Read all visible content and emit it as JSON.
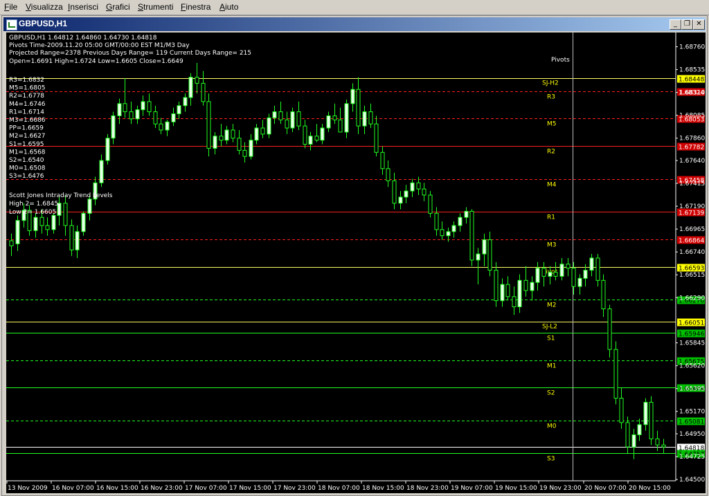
{
  "menubar": {
    "items": [
      {
        "label": "File"
      },
      {
        "label": "Visualizza"
      },
      {
        "label": "Inserisci"
      },
      {
        "label": "Grafici"
      },
      {
        "label": "Strumenti"
      },
      {
        "label": "Finestra"
      },
      {
        "label": "Aiuto"
      }
    ]
  },
  "window": {
    "title": "GBPUSD,H1",
    "buttons": {
      "minimize": "_",
      "restore": "❐",
      "close": "✕"
    }
  },
  "info": {
    "line1": "GBPUSD,H1  1.64812 1.64860 1.64730 1.64818",
    "line2": "Pivots Time-2009.11.20 05:00 GMT/00:00 EST M1/M3 Day",
    "line3": "Projected Range=2378 Previous Days Range= 119 Current Days Range= 215",
    "line4": "Open=1.6691 High=1.6724 Low=1.6605 Close=1.6649",
    "levels": [
      "R3=1.6832",
      "M5=1.6805",
      "R2=1.6778",
      "M4=1.6746",
      "R1=1.6714",
      "M3=1.6686",
      "PP=1.6659",
      "M2=1.6627",
      "S1=1.6595",
      "M1=1.6568",
      "S2=1.6540",
      "M0=1.6508",
      "S3=1.6476"
    ],
    "trend_title": "Scott Jones Intraday Trend Levels",
    "trend_high": "High 2= 1.6845",
    "trend_low": "Low 2= 1.6605"
  },
  "pivots_label": "Pivots",
  "levels": [
    {
      "name": "SJ-H2",
      "tag": "1.68448",
      "color": "#ffff66",
      "dashed": false
    },
    {
      "name": "R3",
      "tag": "1.68324",
      "color": "#ff2020",
      "dashed": true
    },
    {
      "name": "M5",
      "tag": "1.68053",
      "color": "#ff2020",
      "dashed": true
    },
    {
      "name": "R2",
      "tag": "1.67782",
      "color": "#ff2020",
      "dashed": false
    },
    {
      "name": "M4",
      "tag": "1.67458",
      "color": "#ff2020",
      "dashed": true
    },
    {
      "name": "R1",
      "tag": "1.67139",
      "color": "#ff2020",
      "dashed": false
    },
    {
      "name": "M3",
      "tag": "1.66864",
      "color": "#ff2020",
      "dashed": true
    },
    {
      "name": "Pivot",
      "tag": "1.66593",
      "color": "#ffff66",
      "dashed": false
    },
    {
      "name": "M2",
      "tag": "1.66270",
      "color": "#20ff20",
      "dashed": true
    },
    {
      "name": "SJ-L2",
      "tag": "1.66051",
      "color": "#ffff66",
      "dashed": false
    },
    {
      "name": "S1",
      "tag": "1.65946",
      "color": "#20ff20",
      "dashed": false
    },
    {
      "name": "M1",
      "tag": "1.65675",
      "color": "#20ff20",
      "dashed": true
    },
    {
      "name": "S2",
      "tag": "1.65404",
      "color": "#20ff20",
      "dashed": false
    },
    {
      "name": "M0",
      "tag": "1.65081",
      "color": "#20ff20",
      "dashed": true
    },
    {
      "name": "current",
      "tag": "1.64818",
      "color": "#ffffff",
      "dashed": false
    },
    {
      "name": "S3",
      "tag": "1.64757",
      "color": "#20ff20",
      "dashed": false
    }
  ],
  "price_axis": [
    "1.68760",
    "1.68535",
    "1.68310",
    "1.68085",
    "1.67860",
    "1.67640",
    "1.67415",
    "1.67190",
    "1.66965",
    "1.66740",
    "1.66515",
    "1.66290",
    "1.65845",
    "1.65620",
    "1.65395",
    "1.65170",
    "1.64950",
    "1.64725",
    "1.64500"
  ],
  "time_axis": [
    "13 Nov 2009",
    "16 Nov 07:00",
    "16 Nov 15:00",
    "16 Nov 23:00",
    "17 Nov 07:00",
    "17 Nov 15:00",
    "17 Nov 23:00",
    "18 Nov 07:00",
    "18 Nov 15:00",
    "18 Nov 23:00",
    "19 Nov 07:00",
    "19 Nov 15:00",
    "19 Nov 23:00",
    "20 Nov 07:00",
    "20 Nov 15:00"
  ],
  "colors": {
    "background": "#000000",
    "bull": "#e8ffe8",
    "bear": "#000000",
    "wick": "#20ff20",
    "titlebar": "#0a246a"
  },
  "candles": [
    [
      1.6685,
      1.6692,
      1.667,
      1.668
    ],
    [
      1.6682,
      1.671,
      1.6675,
      1.6705
    ],
    [
      1.6705,
      1.6722,
      1.6698,
      1.6715
    ],
    [
      1.6715,
      1.672,
      1.669,
      1.6695
    ],
    [
      1.6695,
      1.6712,
      1.6688,
      1.6708
    ],
    [
      1.6708,
      1.6716,
      1.6692,
      1.67
    ],
    [
      1.67,
      1.6708,
      1.669,
      1.6696
    ],
    [
      1.6696,
      1.6712,
      1.6692,
      1.671
    ],
    [
      1.671,
      1.6728,
      1.67,
      1.6722
    ],
    [
      1.6722,
      1.673,
      1.669,
      1.67
    ],
    [
      1.67,
      1.6706,
      1.667,
      1.6676
    ],
    [
      1.6676,
      1.67,
      1.6668,
      1.6694
    ],
    [
      1.6694,
      1.6714,
      1.669,
      1.6712
    ],
    [
      1.6712,
      1.673,
      1.6705,
      1.6726
    ],
    [
      1.6726,
      1.6748,
      1.672,
      1.6742
    ],
    [
      1.6742,
      1.677,
      1.6738,
      1.6764
    ],
    [
      1.6764,
      1.679,
      1.676,
      1.6786
    ],
    [
      1.6786,
      1.6812,
      1.678,
      1.6808
    ],
    [
      1.6808,
      1.6825,
      1.68,
      1.682
    ],
    [
      1.682,
      1.6845,
      1.6806,
      1.6812
    ],
    [
      1.6812,
      1.6822,
      1.68,
      1.6805
    ],
    [
      1.6805,
      1.6818,
      1.68,
      1.6814
    ],
    [
      1.6814,
      1.6828,
      1.6808,
      1.6822
    ],
    [
      1.6822,
      1.683,
      1.6808,
      1.6812
    ],
    [
      1.6812,
      1.6818,
      1.6796,
      1.68
    ],
    [
      1.68,
      1.6806,
      1.679,
      1.6794
    ],
    [
      1.6794,
      1.6804,
      1.6788,
      1.6802
    ],
    [
      1.6802,
      1.6816,
      1.6798,
      1.681
    ],
    [
      1.681,
      1.6822,
      1.6805,
      1.6818
    ],
    [
      1.6818,
      1.683,
      1.6812,
      1.6826
    ],
    [
      1.6826,
      1.685,
      1.6818,
      1.6846
    ],
    [
      1.6846,
      1.686,
      1.683,
      1.684
    ],
    [
      1.684,
      1.6852,
      1.6818,
      1.6822
    ],
    [
      1.6822,
      1.683,
      1.6768,
      1.6776
    ],
    [
      1.6776,
      1.6792,
      1.677,
      1.6788
    ],
    [
      1.6788,
      1.68,
      1.6778,
      1.6784
    ],
    [
      1.6784,
      1.6798,
      1.678,
      1.6794
    ],
    [
      1.6794,
      1.68,
      1.6782,
      1.6786
    ],
    [
      1.6786,
      1.6794,
      1.677,
      1.6774
    ],
    [
      1.6774,
      1.6782,
      1.6762,
      1.6768
    ],
    [
      1.6768,
      1.679,
      1.6765,
      1.6784
    ],
    [
      1.6784,
      1.68,
      1.678,
      1.6796
    ],
    [
      1.6796,
      1.6804,
      1.6786,
      1.679
    ],
    [
      1.679,
      1.681,
      1.6786,
      1.6806
    ],
    [
      1.6806,
      1.6818,
      1.68,
      1.6812
    ],
    [
      1.6812,
      1.6822,
      1.68,
      1.6804
    ],
    [
      1.6804,
      1.6812,
      1.679,
      1.6796
    ],
    [
      1.6796,
      1.6816,
      1.6792,
      1.6812
    ],
    [
      1.6812,
      1.6822,
      1.6794,
      1.6798
    ],
    [
      1.6798,
      1.6804,
      1.6776,
      1.678
    ],
    [
      1.678,
      1.6792,
      1.6774,
      1.6788
    ],
    [
      1.6788,
      1.68,
      1.6782,
      1.6784
    ],
    [
      1.6784,
      1.68,
      1.678,
      1.6796
    ],
    [
      1.6796,
      1.6812,
      1.6792,
      1.6808
    ],
    [
      1.6808,
      1.682,
      1.68,
      1.6804
    ],
    [
      1.6804,
      1.6816,
      1.6798,
      1.6792
    ],
    [
      1.6792,
      1.6824,
      1.6786,
      1.682
    ],
    [
      1.682,
      1.684,
      1.6812,
      1.6834
    ],
    [
      1.6834,
      1.6846,
      1.679,
      1.6798
    ],
    [
      1.6798,
      1.6818,
      1.679,
      1.6812
    ],
    [
      1.6812,
      1.682,
      1.6796,
      1.68
    ],
    [
      1.68,
      1.6808,
      1.6768,
      1.6772
    ],
    [
      1.6772,
      1.6778,
      1.675,
      1.6756
    ],
    [
      1.6756,
      1.6764,
      1.6738,
      1.6744
    ],
    [
      1.6744,
      1.6752,
      1.6716,
      1.6722
    ],
    [
      1.6722,
      1.6734,
      1.6716,
      1.6728
    ],
    [
      1.6728,
      1.674,
      1.6722,
      1.6734
    ],
    [
      1.6734,
      1.6746,
      1.6728,
      1.6742
    ],
    [
      1.6742,
      1.6748,
      1.673,
      1.6736
    ],
    [
      1.6736,
      1.6742,
      1.6724,
      1.673
    ],
    [
      1.673,
      1.6734,
      1.6708,
      1.6712
    ],
    [
      1.6712,
      1.6718,
      1.669,
      1.6696
    ],
    [
      1.6696,
      1.6704,
      1.6686,
      1.669
    ],
    [
      1.669,
      1.6698,
      1.6684,
      1.6694
    ],
    [
      1.6694,
      1.6704,
      1.6688,
      1.67
    ],
    [
      1.67,
      1.6712,
      1.6694,
      1.6708
    ],
    [
      1.6708,
      1.6718,
      1.6702,
      1.6714
    ],
    [
      1.6714,
      1.6716,
      1.666,
      1.6666
    ],
    [
      1.6666,
      1.6678,
      1.6642,
      1.6672
    ],
    [
      1.6672,
      1.6692,
      1.666,
      1.6686
    ],
    [
      1.6686,
      1.6694,
      1.665,
      1.6656
    ],
    [
      1.6656,
      1.6664,
      1.662,
      1.6626
    ],
    [
      1.6626,
      1.6648,
      1.662,
      1.6642
    ],
    [
      1.6642,
      1.665,
      1.6626,
      1.663
    ],
    [
      1.663,
      1.664,
      1.6612,
      1.662
    ],
    [
      1.662,
      1.6652,
      1.6614,
      1.6646
    ],
    [
      1.6646,
      1.666,
      1.663,
      1.6636
    ],
    [
      1.6636,
      1.665,
      1.6626,
      1.6644
    ],
    [
      1.6644,
      1.6664,
      1.6636,
      1.6658
    ],
    [
      1.6658,
      1.6664,
      1.664,
      1.665
    ],
    [
      1.665,
      1.666,
      1.6642,
      1.6654
    ],
    [
      1.6654,
      1.6664,
      1.6646,
      1.665
    ],
    [
      1.665,
      1.6668,
      1.6646,
      1.6662
    ],
    [
      1.6662,
      1.6668,
      1.665,
      1.6658
    ],
    [
      1.6658,
      1.6664,
      1.6632,
      1.664
    ],
    [
      1.664,
      1.6652,
      1.6632,
      1.6648
    ],
    [
      1.6648,
      1.6662,
      1.664,
      1.6656
    ],
    [
      1.6656,
      1.6672,
      1.665,
      1.6668
    ],
    [
      1.6668,
      1.6672,
      1.664,
      1.6646
    ],
    [
      1.6646,
      1.6652,
      1.661,
      1.6618
    ],
    [
      1.6618,
      1.6622,
      1.657,
      1.6578
    ],
    [
      1.6578,
      1.6586,
      1.6524,
      1.653
    ],
    [
      1.653,
      1.654,
      1.65,
      1.6506
    ],
    [
      1.6506,
      1.6512,
      1.6476,
      1.6482
    ],
    [
      1.6482,
      1.65,
      1.647,
      1.6494
    ],
    [
      1.6494,
      1.651,
      1.6488,
      1.6504
    ],
    [
      1.6504,
      1.653,
      1.6498,
      1.6526
    ],
    [
      1.6526,
      1.6532,
      1.6484,
      1.649
    ],
    [
      1.649,
      1.6498,
      1.6478,
      1.6484
    ],
    [
      1.6484,
      1.649,
      1.6476,
      1.6482
    ]
  ]
}
